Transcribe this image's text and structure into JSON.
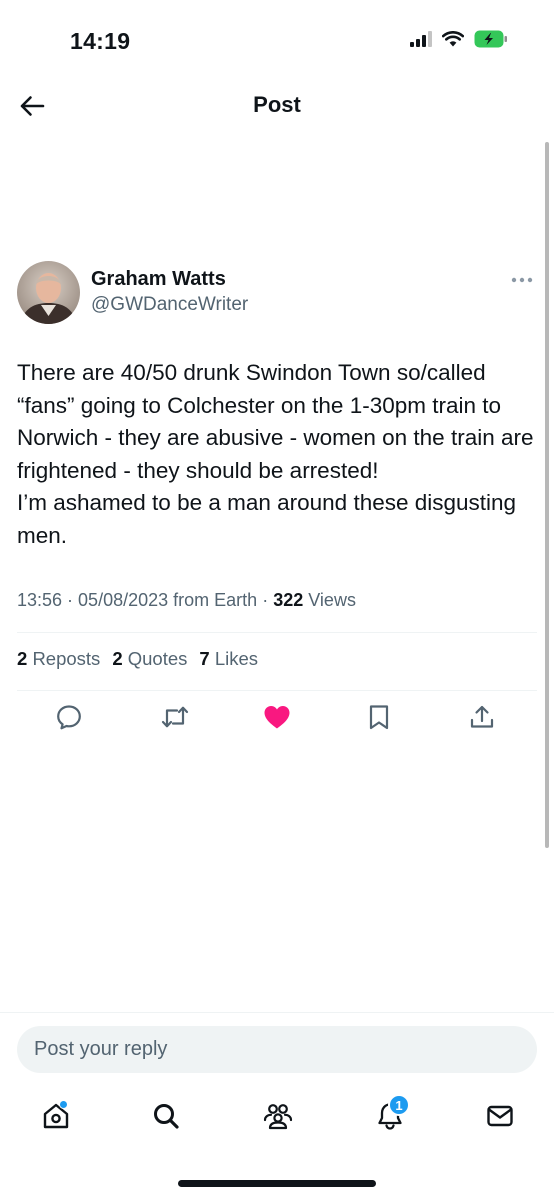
{
  "status_bar": {
    "time": "14:19"
  },
  "header": {
    "title": "Post"
  },
  "post": {
    "author_name": "Graham Watts",
    "author_handle": "@GWDanceWriter",
    "text": "There are 40/50 drunk Swindon Town so/called “fans” going to Colchester on the 1-30pm train to Norwich - they are abusive - women on the train are frightened - they should be arrested!\nI’m ashamed to be a man around these disgusting men.",
    "time": "13:56",
    "date": "05/08/2023",
    "source": "from Earth",
    "views_count": "322",
    "views_label": "Views",
    "reposts_count": "2",
    "reposts_label": "Reposts",
    "quotes_count": "2",
    "quotes_label": "Quotes",
    "likes_count": "7",
    "likes_label": "Likes",
    "liked": true
  },
  "reply": {
    "placeholder": "Post your reply"
  },
  "tabbar": {
    "notifications_badge": "1"
  },
  "colors": {
    "accent": "#1d9bf0",
    "like": "#f91880",
    "text": "#0f1419",
    "secondary": "#536471"
  },
  "icons": [
    "back-arrow-icon",
    "more-options-icon",
    "reply-icon",
    "repost-icon",
    "like-icon",
    "bookmark-icon",
    "share-icon",
    "home-icon",
    "search-icon",
    "communities-icon",
    "notifications-icon",
    "messages-icon",
    "signal-icon",
    "wifi-icon",
    "battery-icon"
  ]
}
